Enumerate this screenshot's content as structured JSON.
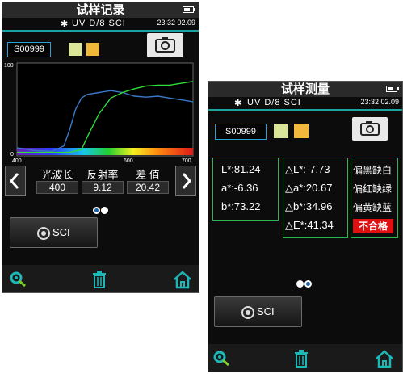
{
  "screen_record": {
    "title": "试样记录",
    "status": {
      "mode": "UV  D/8    SCI",
      "time": "23:32 02.09"
    },
    "sample": "S00999",
    "swatches": [
      "#dbe59a",
      "#f0b93b"
    ],
    "chart_data": {
      "type": "line",
      "x_range": [
        400,
        700
      ],
      "y_range": [
        0,
        100
      ],
      "tick_labels": {
        "x_left": "400",
        "x_mid": "600",
        "x_right": "700",
        "y_top": "100",
        "y_bottom": "0"
      },
      "series": [
        {
          "color": "#3a78c8",
          "x": [
            400,
            430,
            460,
            480,
            490,
            500,
            510,
            520,
            540,
            560,
            580,
            600,
            620,
            640,
            660,
            680,
            700
          ],
          "y": [
            8,
            5,
            4,
            10,
            28,
            50,
            62,
            66,
            68,
            70,
            68,
            64,
            63,
            64,
            62,
            60,
            58
          ]
        },
        {
          "color": "#2fdc3a",
          "x": [
            400,
            430,
            460,
            490,
            510,
            520,
            540,
            560,
            580,
            600,
            620,
            640,
            660,
            680,
            700
          ],
          "y": [
            3,
            3,
            3,
            3,
            6,
            20,
            45,
            62,
            68,
            72,
            75,
            76,
            76,
            78,
            80
          ]
        }
      ]
    },
    "table": {
      "headers": [
        "光波长",
        "反射率",
        "差  值"
      ],
      "values": [
        "400",
        "9.12",
        "20.42"
      ]
    },
    "button": "SCI",
    "bottom_icons": [
      "search-icon",
      "trash-icon",
      "home-icon"
    ]
  },
  "screen_measure": {
    "title": "试样测量",
    "status": {
      "mode": "UV  D/8    SCI",
      "time": "23:32 02.09"
    },
    "sample": "S00999",
    "swatches": [
      "#dbe59a",
      "#f0b93b"
    ],
    "lab": [
      "L*:81.24",
      "a*:-6.36",
      "b*:73.22"
    ],
    "deltas": [
      {
        "sym": "△L*",
        "val": ":-7.73"
      },
      {
        "sym": "△a*",
        "val": ":20.67"
      },
      {
        "sym": "△b*",
        "val": ":34.96"
      },
      {
        "sym": "△E*",
        "val": ":41.34"
      }
    ],
    "eval": [
      "偏黑缺白",
      "偏红缺绿",
      "偏黄缺蓝"
    ],
    "result": "不合格",
    "button": "SCI",
    "bottom_icons": [
      "search-icon",
      "trash-icon",
      "home-icon"
    ]
  }
}
